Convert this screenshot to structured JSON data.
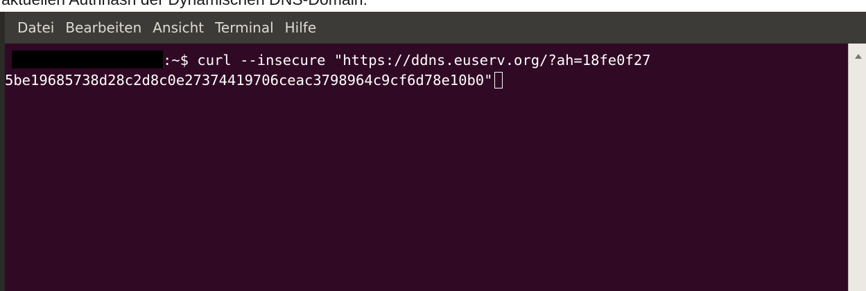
{
  "document": {
    "caption": "aktuellen Authhash der Dynamischen DNS-Domain:"
  },
  "menubar": {
    "items": [
      {
        "label": "Datei"
      },
      {
        "label": "Bearbeiten"
      },
      {
        "label": "Ansicht"
      },
      {
        "label": "Terminal"
      },
      {
        "label": "Hilfe"
      }
    ]
  },
  "terminal": {
    "prompt": ":~$ ",
    "command_line_1": "curl --insecure \"https://ddns.euserv.org/?ah=18fe0f27",
    "command_line_2": "5be19685738d28c2d8c0e27374419706ceac3798964c9cf6d78e10b0\"",
    "background_color": "#300a24",
    "text_color": "#ffffff"
  },
  "scrollbar": {
    "up_arrow_icon": "triangle-up"
  }
}
